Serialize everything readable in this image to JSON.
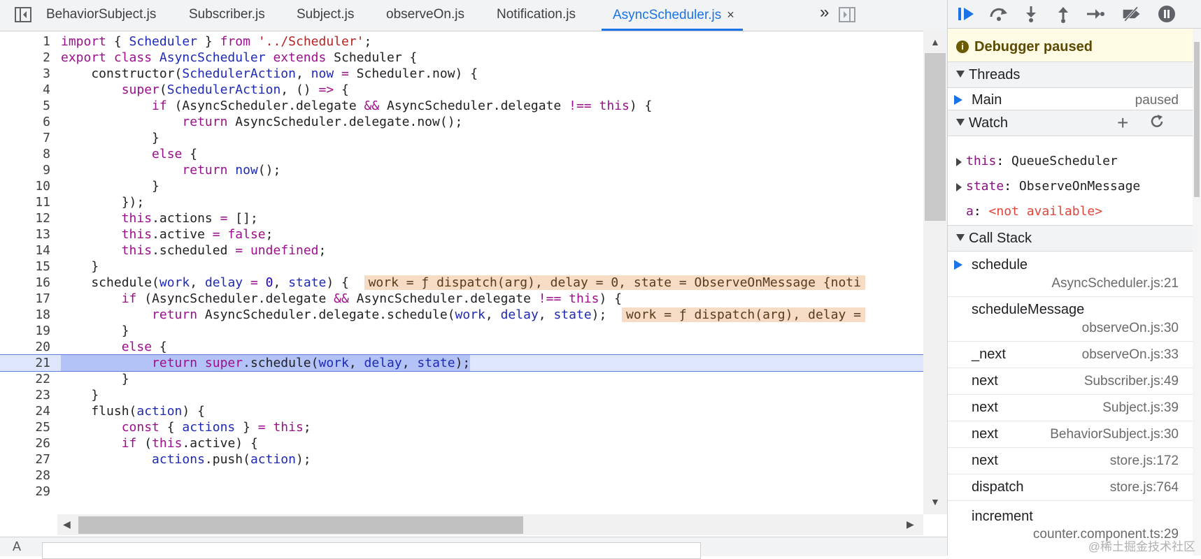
{
  "editor": {
    "tabs": [
      {
        "label": "BehaviorSubject.js",
        "active": false
      },
      {
        "label": "Subscriber.js",
        "active": false
      },
      {
        "label": "Subject.js",
        "active": false
      },
      {
        "label": "observeOn.js",
        "active": false
      },
      {
        "label": "Notification.js",
        "active": false
      },
      {
        "label": "AsyncScheduler.js",
        "active": true
      }
    ],
    "close_glyph": "×",
    "more_tabs_glyph": "»",
    "current_line": 21,
    "lines": [
      {
        "n": "1"
      },
      {
        "n": "2"
      },
      {
        "n": "3"
      },
      {
        "n": "4"
      },
      {
        "n": "5"
      },
      {
        "n": "6"
      },
      {
        "n": "7"
      },
      {
        "n": "8"
      },
      {
        "n": "9"
      },
      {
        "n": "10"
      },
      {
        "n": "11"
      },
      {
        "n": "12"
      },
      {
        "n": "13"
      },
      {
        "n": "14"
      },
      {
        "n": "15"
      },
      {
        "n": "16"
      },
      {
        "n": "17"
      },
      {
        "n": "18"
      },
      {
        "n": "19"
      },
      {
        "n": "20"
      },
      {
        "n": "21"
      },
      {
        "n": "22"
      },
      {
        "n": "23"
      },
      {
        "n": "24"
      },
      {
        "n": "25"
      },
      {
        "n": "26"
      },
      {
        "n": "27"
      },
      {
        "n": "28"
      },
      {
        "n": "29"
      }
    ],
    "inline_values": {
      "line16": "work = ƒ dispatch(arg), delay = 0, state = ObserveOnMessage {noti",
      "line18": "work = ƒ dispatch(arg), delay ="
    }
  },
  "debugger": {
    "status": "Debugger paused",
    "sections": {
      "threads": "Threads",
      "watch": "Watch",
      "call_stack": "Call Stack"
    },
    "threads": [
      {
        "name": "Main",
        "state": "paused"
      }
    ],
    "watch": [
      {
        "key": "this",
        "value": "QueueScheduler",
        "expandable": true
      },
      {
        "key": "state",
        "value": "ObserveOnMessage",
        "expandable": true
      },
      {
        "key": "a",
        "value": "<not available>",
        "expandable": false
      }
    ],
    "call_stack": [
      {
        "fn": "schedule",
        "loc": "AsyncScheduler.js:21",
        "current": true
      },
      {
        "fn": "scheduleMessage",
        "loc": "observeOn.js:30",
        "current": false
      },
      {
        "fn": "_next",
        "loc": "observeOn.js:33",
        "current": false
      },
      {
        "fn": "next",
        "loc": "Subscriber.js:49",
        "current": false
      },
      {
        "fn": "next",
        "loc": "Subject.js:39",
        "current": false
      },
      {
        "fn": "next",
        "loc": "BehaviorSubject.js:30",
        "current": false
      },
      {
        "fn": "next",
        "loc": "store.js:172",
        "current": false
      },
      {
        "fn": "dispatch",
        "loc": "store.js:764",
        "current": false
      },
      {
        "fn": "increment",
        "loc": "counter.component.ts:29",
        "current": false
      }
    ],
    "watermark": "@稀土掘金技术社区"
  },
  "colors": {
    "accent": "#1a73e8",
    "paused_bg": "#fffbe5",
    "current_line_bg": "#dde6fb",
    "inline_value_bg": "#f7dcc5"
  }
}
